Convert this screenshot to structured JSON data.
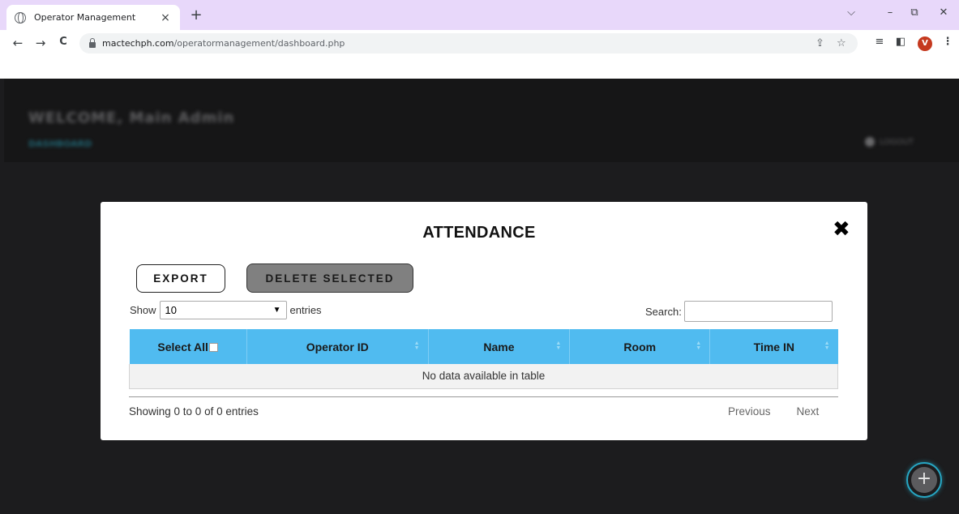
{
  "browser": {
    "tab_title": "Operator Management",
    "tab_close": "×",
    "new_tab": "+",
    "url_host": "mactechph.com",
    "url_path": "/operatormanagement/dashboard.php",
    "profile_initial": "V",
    "window_controls": {
      "dropdown": "⌵",
      "minimize": "–",
      "restore": "⧉",
      "close": "✕"
    },
    "nav": {
      "back": "←",
      "forward": "→",
      "reload": "C"
    }
  },
  "page": {
    "welcome": "WELCOME, Main Admin",
    "dashboard_link": "DASHBOARD",
    "logout": "LOGOUT",
    "fab_icon": "+"
  },
  "modal": {
    "title": "ATTENDANCE",
    "close_icon": "✖",
    "export_label": "EXPORT",
    "delete_label": "DELETE SELECTED",
    "show_label": "Show",
    "length_value": "10",
    "entries_label": "entries",
    "search_label": "Search:",
    "search_value": "",
    "columns": [
      "Select All",
      "Operator ID",
      "Name",
      "Room",
      "Time IN"
    ],
    "empty_message": "No data available in table",
    "info": "Showing 0 to 0 of 0 entries",
    "previous": "Previous",
    "next": "Next"
  },
  "colors": {
    "header_bg": "#50bbf0",
    "delete_btn": "#808080",
    "tab_bar": "#e8d8fa",
    "fab_ring": "#27a6c3"
  }
}
